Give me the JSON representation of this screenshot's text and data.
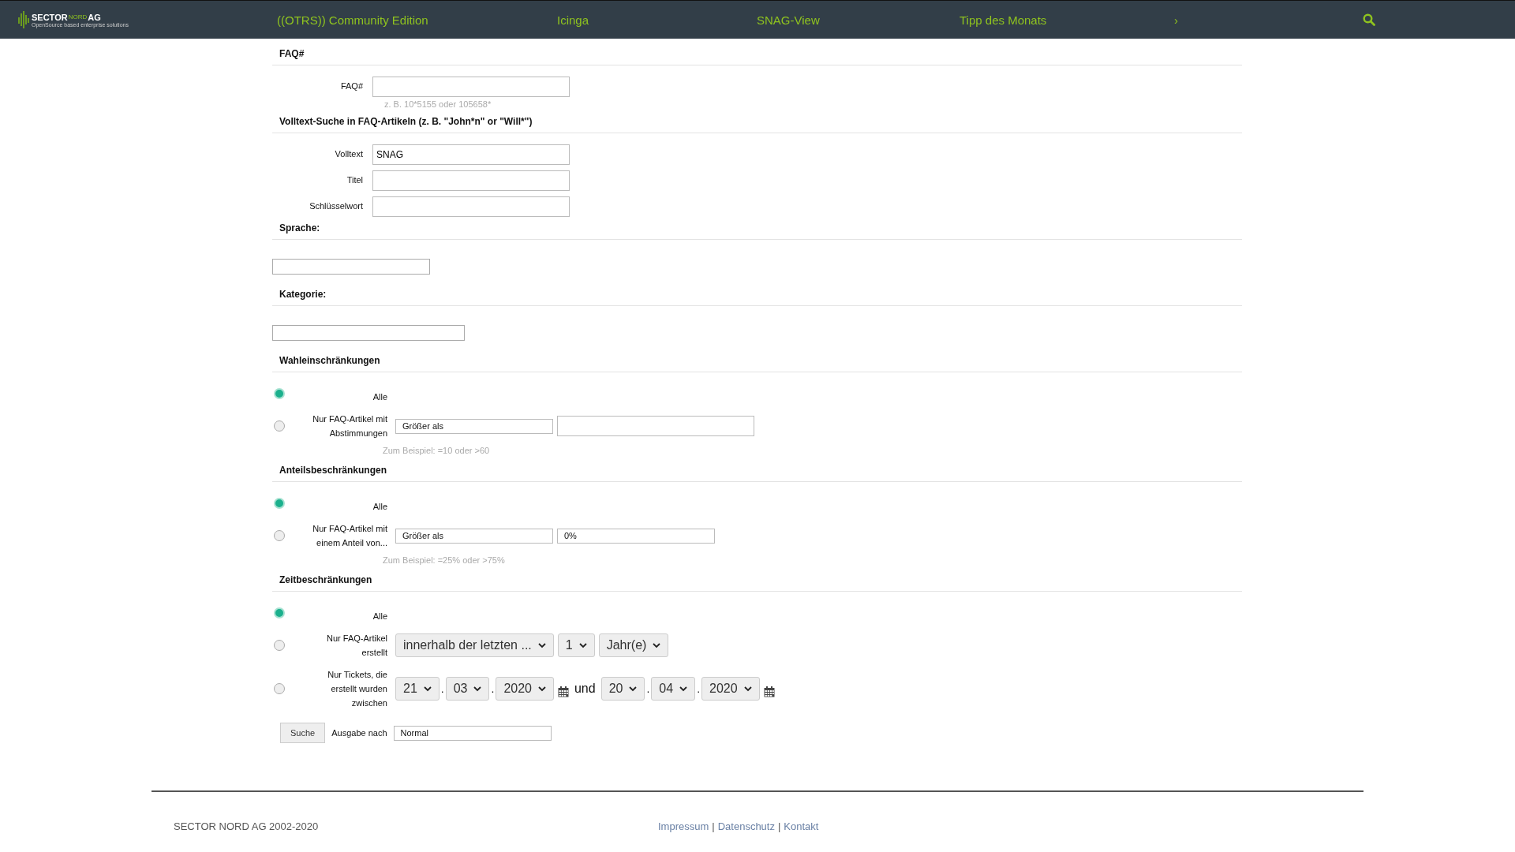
{
  "nav": {
    "logo": {
      "name": "SECTOR",
      "sup": "NORD",
      "suffix": "AG",
      "tagline": "OpenSource based enterprise solutions"
    },
    "items": [
      {
        "label": "((OTRS)) Community Edition"
      },
      {
        "label": "Icinga"
      },
      {
        "label": "SNAG-View"
      },
      {
        "label": "Tipp des Monats"
      },
      {
        "label": "›"
      }
    ]
  },
  "sections": [
    {
      "kind": "fields",
      "title": "FAQ#",
      "fields": [
        {
          "label": "FAQ#",
          "hint": "z. B. 10*5155 oder 105658*"
        }
      ]
    },
    {
      "kind": "fields",
      "title": "Volltext-Suche in FAQ-Artikeln (z. B. \"John*n\" or \"Will*\")",
      "fields": [
        {
          "label": "Volltext",
          "value": "SNAG"
        },
        {
          "label": "Titel"
        },
        {
          "label": "Schlüsselwort"
        }
      ]
    },
    {
      "kind": "select",
      "title": "Sprache:"
    },
    {
      "kind": "select",
      "title": "Kategorie:"
    },
    {
      "kind": "radios",
      "title": "Wahleinschränkungen",
      "options": [
        {
          "label": "Alle",
          "selected": true
        },
        {
          "label": "Nur FAQ-Artikel mit\nAbstimmungen",
          "selected": false,
          "controls": [
            {
              "kind": "box",
              "value": "Größer als"
            },
            {
              "kind": "input"
            }
          ],
          "hint": "Zum Beispiel: =10 oder >60"
        }
      ]
    },
    {
      "kind": "radios",
      "title": "Anteilsbeschränkungen",
      "options": [
        {
          "label": "Alle",
          "selected": true
        },
        {
          "label": "Nur FAQ-Artikel mit\neinem Anteil von...",
          "selected": false,
          "controls": [
            {
              "kind": "box",
              "value": "Größer als"
            },
            {
              "kind": "box",
              "value": "0%"
            }
          ],
          "hint": "Zum Beispiel: =25% oder >75%"
        }
      ]
    },
    {
      "kind": "radios",
      "title": "Zeitbeschränkungen",
      "options": [
        {
          "label": "Alle",
          "selected": true
        },
        {
          "label": "Nur FAQ-Artikel\nerstellt",
          "selected": false,
          "controls": [
            {
              "kind": "dropdown",
              "value": "innerhalb der letzten ..."
            },
            {
              "kind": "dropdown",
              "value": "1"
            },
            {
              "kind": "dropdown",
              "value": "Jahr(e)"
            }
          ]
        },
        {
          "label": "Nur Tickets, die\nerstellt wurden\nzwischen",
          "selected": false,
          "controls": [
            {
              "kind": "dropdown",
              "value": "21"
            },
            {
              "kind": "sep",
              "value": "."
            },
            {
              "kind": "dropdown",
              "value": "03"
            },
            {
              "kind": "sep",
              "value": "."
            },
            {
              "kind": "dropdown",
              "value": "2020"
            },
            {
              "kind": "calendar"
            },
            {
              "kind": "word",
              "value": "und"
            },
            {
              "kind": "dropdown",
              "value": "20"
            },
            {
              "kind": "sep",
              "value": "."
            },
            {
              "kind": "dropdown",
              "value": "04"
            },
            {
              "kind": "sep",
              "value": "."
            },
            {
              "kind": "dropdown",
              "value": "2020"
            },
            {
              "kind": "calendar"
            }
          ]
        }
      ]
    }
  ],
  "actions": {
    "button": "Suche",
    "output_label": "Ausgabe nach",
    "output_value": "Normal"
  },
  "footer": {
    "copyright": "SECTOR NORD AG 2002-2020",
    "links": [
      "Impressum",
      "Datenschutz",
      "Kontakt"
    ],
    "separator": "|"
  }
}
